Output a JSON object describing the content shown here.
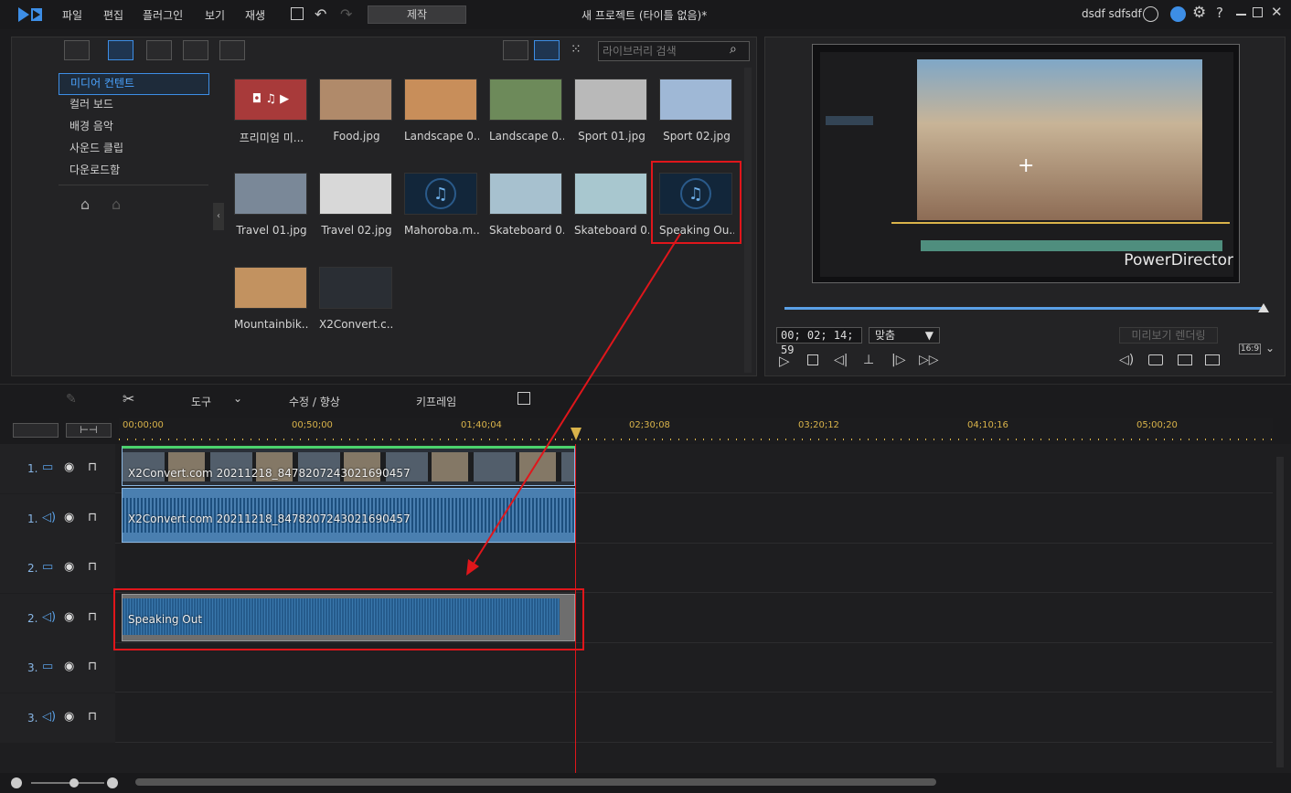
{
  "menu": [
    "파일",
    "편집",
    "플러그인",
    "보기",
    "재생"
  ],
  "produce_label": "제작",
  "project_title": "새 프로젝트 (타이틀 없음)*",
  "user_name": "dsdf sdfsdf",
  "search": {
    "placeholder": "라이브러리 검색"
  },
  "categories": [
    "미디어 컨텐트",
    "컬러 보드",
    "배경 음악",
    "사운드 클립",
    "다운로드함"
  ],
  "media": [
    {
      "label": "프리미엄 미...",
      "kind": "premium"
    },
    {
      "label": "Food.jpg",
      "kind": "photo"
    },
    {
      "label": "Landscape 0...",
      "kind": "photo"
    },
    {
      "label": "Landscape 0...",
      "kind": "photo"
    },
    {
      "label": "Sport 01.jpg",
      "kind": "photo"
    },
    {
      "label": "Sport 02.jpg",
      "kind": "photo"
    },
    {
      "label": "Travel 01.jpg",
      "kind": "photo"
    },
    {
      "label": "Travel 02.jpg",
      "kind": "photo"
    },
    {
      "label": "Mahoroba.m...",
      "kind": "music"
    },
    {
      "label": "Skateboard 0...",
      "kind": "video"
    },
    {
      "label": "Skateboard 0...",
      "kind": "video"
    },
    {
      "label": "Speaking Ou...",
      "kind": "music"
    },
    {
      "label": "Mountainbik...",
      "kind": "video"
    },
    {
      "label": "X2Convert.c...",
      "kind": "video"
    }
  ],
  "preview": {
    "watermark": "PowerDirector",
    "timecode": "00; 02; 14; 59",
    "fit": "맞춤",
    "render_label": "미리보기 렌더링",
    "aspect": "16:9"
  },
  "edit_toolbar": {
    "tools": "도구",
    "fix": "수정 / 향상",
    "keyframe": "키프레임"
  },
  "ruler_ticks": [
    "00;00;00",
    "00;50;00",
    "01;40;04",
    "02;30;08",
    "03;20;12",
    "04;10;16",
    "05;00;20"
  ],
  "tracks": [
    {
      "num": "1.",
      "type": "video"
    },
    {
      "num": "1.",
      "type": "audio"
    },
    {
      "num": "2.",
      "type": "video"
    },
    {
      "num": "2.",
      "type": "audio"
    },
    {
      "num": "3.",
      "type": "video"
    },
    {
      "num": "3.",
      "type": "audio"
    }
  ],
  "clips": {
    "video1": "X2Convert.com 20211218_84782072430216904​57",
    "audio1": "X2Convert.com 20211218_847820724302169045​7",
    "audio2": "Speaking Out"
  },
  "colors": {
    "accent": "#3d8ee6",
    "highlight": "#e0161b",
    "ruler": "#d9b34a"
  }
}
